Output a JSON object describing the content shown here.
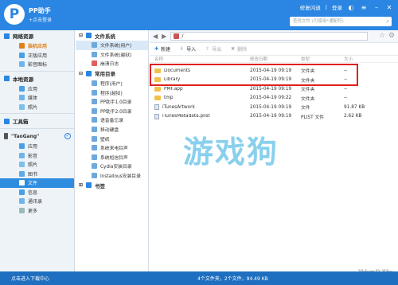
{
  "app": {
    "logo": "P",
    "title": "PP助手",
    "login_hint": "+点击登录"
  },
  "top": {
    "links": [
      "修复闪退",
      "登录",
      "皮肤"
    ],
    "search_placeholder": "查找文件 (可使用*通配符)"
  },
  "left": {
    "network_head": "网络资源",
    "network_items": [
      {
        "label": "装机应用",
        "icon": "bag-icon",
        "active": true
      },
      {
        "label": "正版应用",
        "icon": "apps-icon"
      },
      {
        "label": "影音图标",
        "icon": "media-icon"
      }
    ],
    "local_head": "本地资源",
    "local_items": [
      {
        "label": "应用",
        "icon": "apps-icon"
      },
      {
        "label": "媒体",
        "icon": "media-icon"
      },
      {
        "label": "照片",
        "icon": "photo-icon"
      }
    ],
    "toolbox": "工具箱",
    "device": "\"TaoGang\"",
    "device_items": [
      {
        "label": "应用",
        "icon": "apps-icon"
      },
      {
        "label": "影音",
        "icon": "media-icon"
      },
      {
        "label": "照片",
        "icon": "photo-icon"
      },
      {
        "label": "图书",
        "icon": "book-icon"
      },
      {
        "label": "文件",
        "icon": "file-icon",
        "selected": true
      },
      {
        "label": "信息",
        "icon": "message-icon"
      },
      {
        "label": "通讯录",
        "icon": "contacts-icon"
      },
      {
        "label": "更多",
        "icon": "more-icon"
      }
    ]
  },
  "tree": {
    "fs_head": "文件系统",
    "fs_items": [
      "文件系统(用户)",
      "文件系统(越狱)",
      "崩溃日志"
    ],
    "common_head": "常用目录",
    "common_items": [
      "程序(用户)",
      "程序(越狱)",
      "PP助手1.0目录",
      "PP助手2.0目录",
      "语音备忘录",
      "移动硬盘",
      "壁纸",
      "系统来电铃声",
      "系统短信铃声",
      "Cydia安装目录",
      "Installous安装目录"
    ],
    "bookmarks": "书签"
  },
  "content": {
    "path": "/",
    "toolbar": [
      "新建",
      "导入",
      "导出",
      "删除"
    ],
    "columns": [
      "名称",
      "修改日期",
      "类型",
      "大小"
    ],
    "rows": [
      {
        "name": "Documents",
        "date": "2015-04-19 09:19",
        "type": "文件夹",
        "size": "--",
        "folder": true
      },
      {
        "name": "Library",
        "date": "2015-04-19 09:19",
        "type": "文件夹",
        "size": "--",
        "folder": true
      },
      {
        "name": "PMF.app",
        "date": "2015-04-19 09:19",
        "type": "文件夹",
        "size": "--",
        "folder": true
      },
      {
        "name": "tmp",
        "date": "2015-04-19 09:22",
        "type": "文件夹",
        "size": "--",
        "folder": true
      },
      {
        "name": "iTunesArtwork",
        "date": "2015-04-19 09:19",
        "type": "文件",
        "size": "91.87 KB",
        "folder": false
      },
      {
        "name": "iTunesMetadata.plist",
        "date": "2015-04-19 09:19",
        "type": "PLIST 文件",
        "size": "2.62 KB",
        "folder": false
      }
    ]
  },
  "watermark": "游戏狗",
  "watermark_bottom": "游戏狗",
  "status": {
    "left": "点击进入下载中心",
    "center": "4个文件夹，2个文件，94.49 KB"
  }
}
